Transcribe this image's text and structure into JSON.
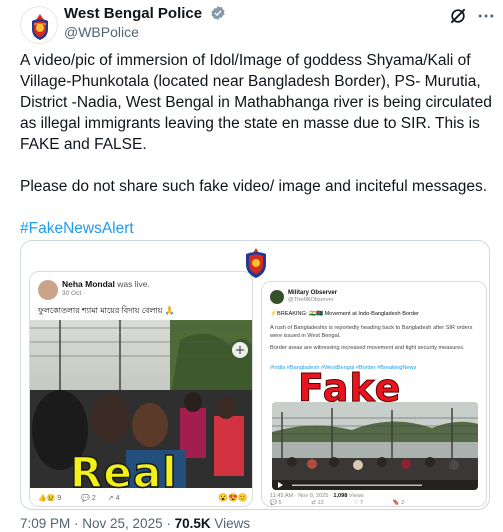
{
  "author": {
    "display_name": "West Bengal Police",
    "handle": "@WBPolice"
  },
  "tweet": {
    "paragraph1": "A video/pic of immersion of Idol/Image of goddess Shyama/Kali  of Village-Phunkotala (located near Bangladesh Border), PS- Murutia, District -Nadia, West Bengal in Mathabhanga river is being circulated as illegal immigrants leaving the state en masse due to SIR. This is FAKE and FALSE.",
    "paragraph2": "Please do not share such fake video/ image and inciteful messages.",
    "hashtag": "#FakeNewsAlert"
  },
  "media": {
    "left_card": {
      "name": "Neha Mondal",
      "status": "was live.",
      "date": "30 Oct · ",
      "caption": "ফুলকোতলার শ্যামা মায়ের বিদায় বেলায় 🙏",
      "stamp": "Real",
      "reaction_like": "9",
      "reaction_comment": "2",
      "reaction_share": "4"
    },
    "right_card": {
      "name": "Military Observer",
      "handle": "@TheMilObserver",
      "headline": "⚡BREAKING: 🇮🇳🇧🇩 Movement at Indo-Bangladesh Border",
      "body1": "A rush of Bangladeshis is reportedly heading back to Bangladesh after SIR orders were issued in West Bengal.",
      "body2": "Border areas are witnessing increased movement and tight security measures.",
      "hashtags": "#India #Bangladesh #WestBengal #Border #BreakingNews",
      "stamp": "Fake",
      "time": "11:45 AM · Nov 9, 2025 · ",
      "views": "1,098",
      "views_label": " Views",
      "stat_reply": "5",
      "stat_retweet": "12",
      "stat_like": "7",
      "stat_bookmark": "2"
    }
  },
  "footer": {
    "timestamp": "7:09 PM · Nov 25, 2025 · ",
    "views": "70.5K",
    "views_label": " Views"
  },
  "colors": {
    "link": "#1d9bf0",
    "verified": "#829aab",
    "real_stamp": "#f2f21a",
    "fake_stamp": "#e8141e"
  },
  "icons": [
    "police-emblem-icon",
    "verified-badge-icon",
    "grok-icon",
    "more-icon"
  ]
}
